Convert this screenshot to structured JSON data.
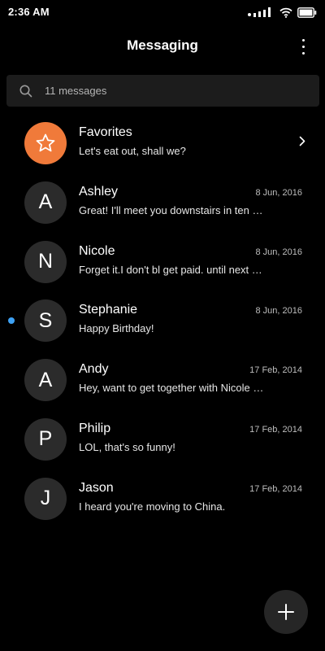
{
  "status_bar": {
    "time": "2:36 AM",
    "icons": [
      "signal-icon",
      "wifi-icon",
      "battery-icon"
    ]
  },
  "header": {
    "title": "Messaging",
    "menu_icon": "more-vertical-icon"
  },
  "search": {
    "icon": "search-icon",
    "text": "11 messages"
  },
  "colors": {
    "background": "#000000",
    "favorites_accent": "#f07a3a",
    "unread_dot": "#3ea2f5",
    "avatar_bg": "#2b2b2b",
    "search_bg": "#1c1c1c"
  },
  "conversations": [
    {
      "initial": "",
      "icon": "star-icon",
      "name": "Favorites",
      "preview": "Let's eat out, shall we?",
      "date": "",
      "trailing_icon": "chevron-right-icon"
    },
    {
      "initial": "A",
      "name": "Ashley",
      "preview": "Great! I'll meet you downstairs in ten …",
      "date": "8 Jun, 2016"
    },
    {
      "initial": "N",
      "name": "Nicole",
      "preview": "Forget it.I don't bl get paid. until next …",
      "date": "8 Jun, 2016"
    },
    {
      "initial": "S",
      "name": "Stephanie",
      "preview": "Happy Birthday!",
      "date": "8 Jun, 2016",
      "unread": true
    },
    {
      "initial": "A",
      "name": "Andy",
      "preview": "Hey, want to get together with Nicole …",
      "date": "17 Feb, 2014"
    },
    {
      "initial": "P",
      "name": "Philip",
      "preview": "LOL, that's so funny!",
      "date": "17 Feb, 2014"
    },
    {
      "initial": "J",
      "name": "Jason",
      "preview": "I heard you're moving to China.",
      "date": "17 Feb, 2014"
    }
  ],
  "fab": {
    "icon": "plus-icon"
  }
}
